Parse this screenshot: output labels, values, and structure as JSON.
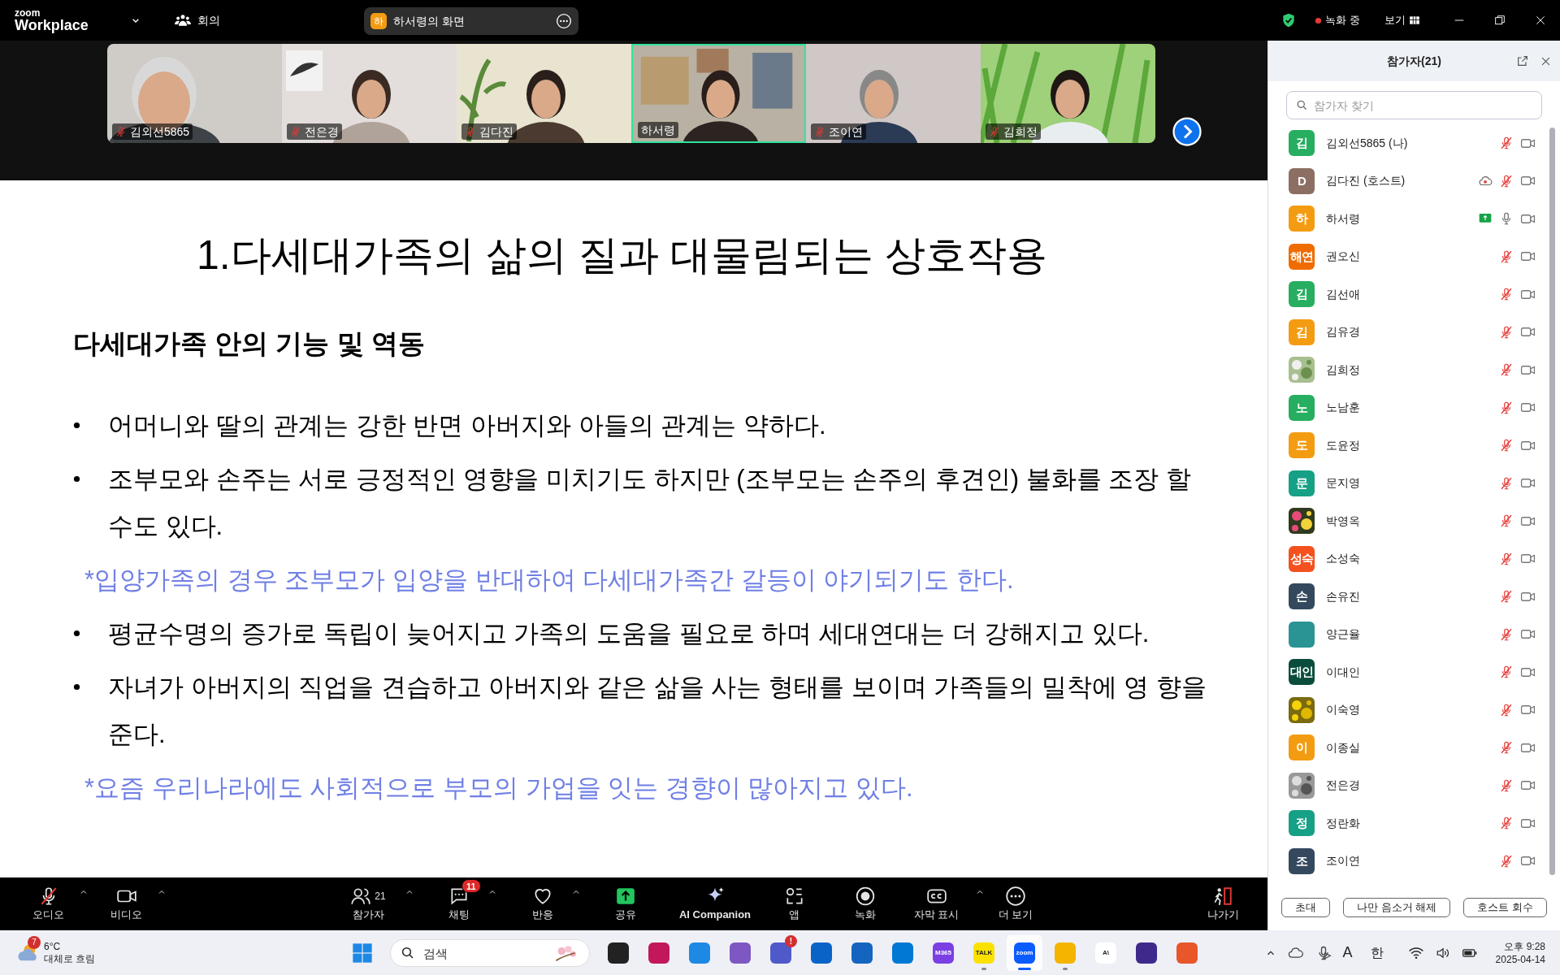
{
  "top_bar": {
    "logo_top": "zoom",
    "logo_bottom": "Workplace",
    "meeting_label": "회의",
    "share_pill": {
      "avatar": "하",
      "label": "하서령의 화면"
    },
    "recording_label": "녹화 중",
    "view_label": "보기"
  },
  "video_tiles": [
    {
      "name": "김외선5865",
      "muted": true,
      "selected": false
    },
    {
      "name": "전은경",
      "muted": true,
      "selected": false
    },
    {
      "name": "김다진",
      "muted": true,
      "selected": false
    },
    {
      "name": "하서령",
      "muted": false,
      "selected": true
    },
    {
      "name": "조이연",
      "muted": true,
      "selected": false
    },
    {
      "name": "김희정",
      "muted": true,
      "selected": false
    }
  ],
  "slide": {
    "title": "1.다세대가족의 삶의 질과 대물림되는 상호작용",
    "heading": "다세대가족 안의 기능 및 역동",
    "items": [
      {
        "kind": "bullet",
        "text": "어머니와 딸의 관계는 강한 반면 아버지와 아들의 관계는 약하다."
      },
      {
        "kind": "bullet",
        "text": "조부모와 손주는 서로 긍정적인 영향을 미치기도 하지만 (조부모는 손주의 후견인) 불화를 조장 할 수도 있다."
      },
      {
        "kind": "note",
        "text": "*입양가족의 경우 조부모가 입양을 반대하여 다세대가족간 갈등이 야기되기도 한다."
      },
      {
        "kind": "bullet",
        "text": "평균수명의 증가로 독립이 늦어지고 가족의 도움을 필요로 하며 세대연대는 더 강해지고 있다."
      },
      {
        "kind": "bullet",
        "text": "자녀가 아버지의 직업을 견습하고 아버지와 같은 삶을 사는 형태를 보이며 가족들의 밀착에 영 향을 준다."
      },
      {
        "kind": "note",
        "text": "*요즘 우리나라에도 사회적으로 부모의 가업을 잇는 경향이 많아지고 있다."
      }
    ]
  },
  "toolbar": {
    "items": [
      {
        "kind": "audio",
        "label": "오디오",
        "caret": true,
        "muted": true
      },
      {
        "kind": "video",
        "label": "비디오",
        "caret": true
      },
      {
        "kind": "participants",
        "label": "참가자",
        "caret": true,
        "count": "21"
      },
      {
        "kind": "chat",
        "label": "채팅",
        "caret": true,
        "badge": "11"
      },
      {
        "kind": "reactions",
        "label": "반응",
        "caret": true
      },
      {
        "kind": "share",
        "label": "공유",
        "caret": false
      },
      {
        "kind": "ai",
        "label": "AI Companion",
        "caret": false
      },
      {
        "kind": "apps",
        "label": "앱",
        "caret": false
      },
      {
        "kind": "record",
        "label": "녹화",
        "caret": false
      },
      {
        "kind": "captions",
        "label": "자막 표시",
        "caret": true
      },
      {
        "kind": "more",
        "label": "더 보기",
        "caret": false
      },
      {
        "kind": "leave",
        "label": "나가기",
        "caret": false
      }
    ]
  },
  "participants_panel": {
    "title": "참가자(21)",
    "search": {
      "placeholder": "참가자 찾기"
    },
    "participants": [
      {
        "name": "김외선5865 (나)",
        "avatar": {
          "kind": "letter",
          "text": "김",
          "color": "#27ae60"
        },
        "muted": true,
        "recording": false,
        "sharing": false
      },
      {
        "name": "김다진 (호스트)",
        "avatar": {
          "kind": "letter",
          "text": "D",
          "color": "#8d6e63"
        },
        "muted": true,
        "recording": true,
        "sharing": false
      },
      {
        "name": "하서령",
        "avatar": {
          "kind": "letter",
          "text": "하",
          "color": "#f39c12"
        },
        "muted": false,
        "recording": false,
        "sharing": true
      },
      {
        "name": "권오신",
        "avatar": {
          "kind": "letter",
          "text": "해연",
          "color": "#ef6c00"
        },
        "muted": true,
        "recording": false,
        "sharing": false
      },
      {
        "name": "김선애",
        "avatar": {
          "kind": "letter",
          "text": "김",
          "color": "#27ae60"
        },
        "muted": true,
        "recording": false,
        "sharing": false
      },
      {
        "name": "김유경",
        "avatar": {
          "kind": "letter",
          "text": "김",
          "color": "#f39c12"
        },
        "muted": true,
        "recording": false,
        "sharing": false
      },
      {
        "name": "김희정",
        "muted": true,
        "recording": false,
        "sharing": false
      },
      {
        "name": "노남훈",
        "avatar": {
          "kind": "letter",
          "text": "노",
          "color": "#27ae60"
        },
        "muted": true,
        "recording": false,
        "sharing": false
      },
      {
        "name": "도윤정",
        "avatar": {
          "kind": "letter",
          "text": "도",
          "color": "#f39c12"
        },
        "muted": true,
        "recording": false,
        "sharing": false
      },
      {
        "name": "문지영",
        "avatar": {
          "kind": "letter",
          "text": "문",
          "color": "#16a085"
        },
        "muted": true,
        "recording": false,
        "sharing": false
      },
      {
        "name": "박영옥",
        "muted": true,
        "recording": false,
        "sharing": false
      },
      {
        "name": "소성숙",
        "avatar": {
          "kind": "letter",
          "text": "성숙",
          "color": "#f4511e"
        },
        "muted": true,
        "recording": false,
        "sharing": false
      },
      {
        "name": "손유진",
        "avatar": {
          "kind": "letter",
          "text": "손",
          "color": "#34495e"
        },
        "muted": true,
        "recording": false,
        "sharing": false
      },
      {
        "name": "양근율",
        "avatar": {
          "kind": "letter",
          "color": "#2a9393"
        },
        "muted": true,
        "recording": false,
        "sharing": false
      },
      {
        "name": "이대인",
        "avatar": {
          "kind": "letter",
          "text": "대인",
          "color": "#0b4d3c"
        },
        "muted": true,
        "recording": false,
        "sharing": false
      },
      {
        "name": "이숙영",
        "muted": true,
        "recording": false,
        "sharing": false
      },
      {
        "name": "이종실",
        "avatar": {
          "kind": "letter",
          "text": "이",
          "color": "#f39c12"
        },
        "muted": true,
        "recording": false,
        "sharing": false
      },
      {
        "name": "전은경",
        "muted": true,
        "recording": false,
        "sharing": false
      },
      {
        "name": "정란화",
        "avatar": {
          "kind": "letter",
          "text": "정",
          "color": "#16a085"
        },
        "muted": true,
        "recording": false,
        "sharing": false
      },
      {
        "name": "조이연",
        "avatar": {
          "kind": "letter",
          "text": "조",
          "color": "#34495e"
        },
        "muted": true,
        "recording": false,
        "sharing": false
      }
    ],
    "buttons": [
      "초대",
      "나만 음소거 해제",
      "호스트 회수"
    ]
  },
  "taskbar": {
    "weather": {
      "badge": "7",
      "temperature": "6°C",
      "condition": "대체로 흐림"
    },
    "search": {
      "placeholder": "검색"
    },
    "apps": [
      {
        "kind": "taskview",
        "color": "#222222"
      },
      {
        "kind": "snip",
        "color": "#c2185b"
      },
      {
        "kind": "edge",
        "color": "#1e88e5"
      },
      {
        "kind": "copilot",
        "color": "#7e57c2"
      },
      {
        "kind": "teams",
        "color": "#5059c9",
        "badge": "!"
      },
      {
        "kind": "outlook",
        "color": "#0a64c8"
      },
      {
        "kind": "store",
        "color": "#1565c0"
      },
      {
        "kind": "outlook",
        "color": "#0078d4"
      },
      {
        "kind": "m365",
        "color": "#7b3fe4",
        "label": "M365"
      },
      {
        "kind": "kakao",
        "color": "#fae100",
        "label": "TALK",
        "active": false
      },
      {
        "kind": "zoom",
        "color": "#0b5cff",
        "label": "zoom",
        "active": true
      },
      {
        "kind": "folder",
        "color": "#f4b400",
        "active": false
      },
      {
        "kind": "ai",
        "color": "#ffffff",
        "label": "A\\"
      },
      {
        "kind": "upload",
        "color": "#3f2a8c"
      },
      {
        "kind": "pie",
        "color": "#e8562a"
      }
    ],
    "tray": {
      "ime_a": "A",
      "ime_lang": "한",
      "time": "오후 9:28",
      "date": "2025-04-14"
    }
  }
}
